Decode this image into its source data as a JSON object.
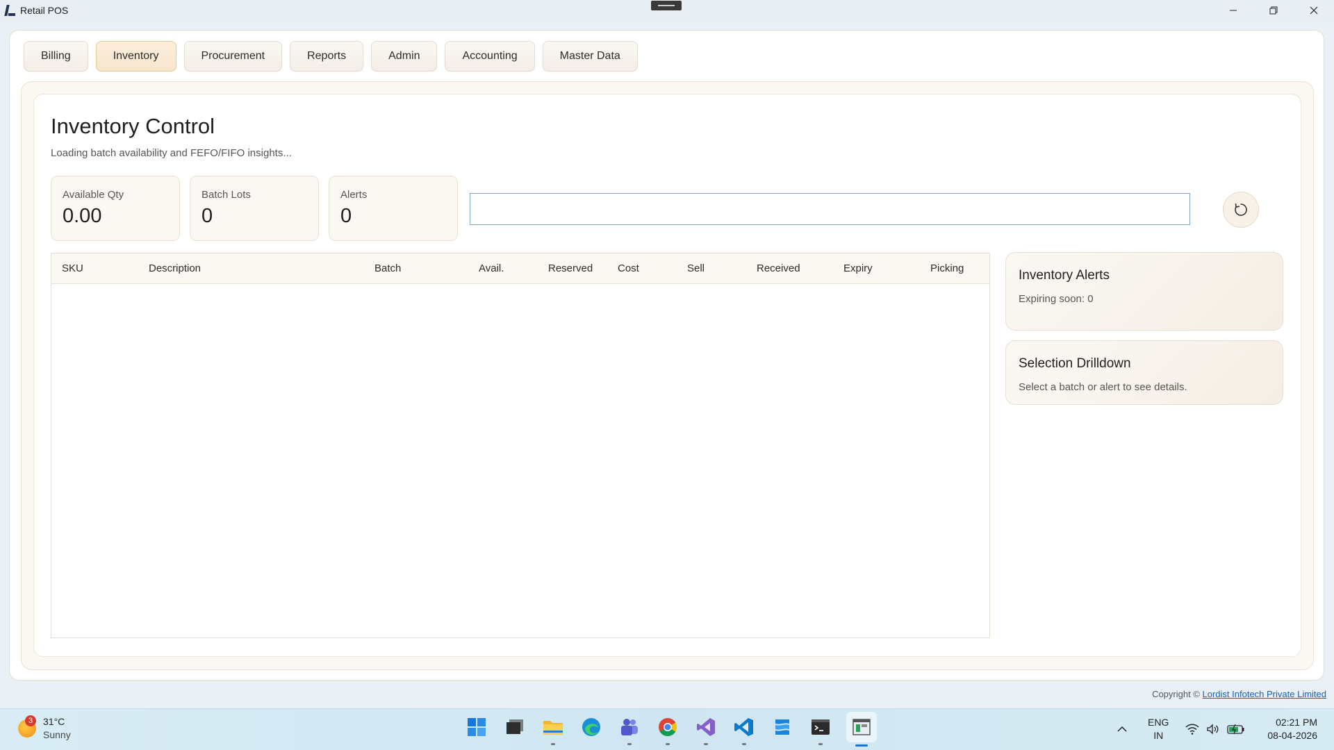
{
  "window": {
    "title": "Retail POS",
    "controls": [
      "minimize-icon",
      "restore-icon",
      "close-icon"
    ]
  },
  "tabs": [
    {
      "label": "Billing",
      "active": false
    },
    {
      "label": "Inventory",
      "active": true
    },
    {
      "label": "Procurement",
      "active": false
    },
    {
      "label": "Reports",
      "active": false
    },
    {
      "label": "Admin",
      "active": false
    },
    {
      "label": "Accounting",
      "active": false
    },
    {
      "label": "Master Data",
      "active": false
    }
  ],
  "inventory": {
    "title": "Inventory Control",
    "subtitle": "Loading batch availability and FEFO/FIFO insights...",
    "stats": [
      {
        "label": "Available Qty",
        "value": "0.00"
      },
      {
        "label": "Batch Lots",
        "value": "0"
      },
      {
        "label": "Alerts",
        "value": "0"
      }
    ],
    "search": {
      "value": "",
      "placeholder": ""
    },
    "refresh_icon": "refresh-icon",
    "table": {
      "columns": [
        "SKU",
        "Description",
        "Batch",
        "Avail.",
        "Reserved",
        "Cost",
        "Sell",
        "Received",
        "Expiry",
        "Picking"
      ],
      "rows": []
    },
    "alerts_card": {
      "title": "Inventory Alerts",
      "text": "Expiring soon: 0"
    },
    "drilldown_card": {
      "title": "Selection Drilldown",
      "text": "Select a batch or alert to see details."
    }
  },
  "footer": {
    "copyright_prefix": "Copyright  ©",
    "company_link": "Lordist Infotech Private Limited"
  },
  "taskbar": {
    "weather": {
      "badge": "3",
      "temp": "31°C",
      "condition": "Sunny"
    },
    "apps": [
      "windows-start-icon",
      "task-view-icon",
      "file-explorer-icon",
      "edge-icon",
      "teams-icon",
      "chrome-icon",
      "visual-studio-icon",
      "vscode-icon",
      "azure-data-studio-icon",
      "terminal-icon",
      "retail-pos-app-icon"
    ],
    "language": {
      "line1": "ENG",
      "line2": "IN"
    },
    "clock": {
      "time": "02:21 PM",
      "date": "08-04-2026"
    },
    "colors": {
      "accent": "#1b74d4"
    }
  }
}
